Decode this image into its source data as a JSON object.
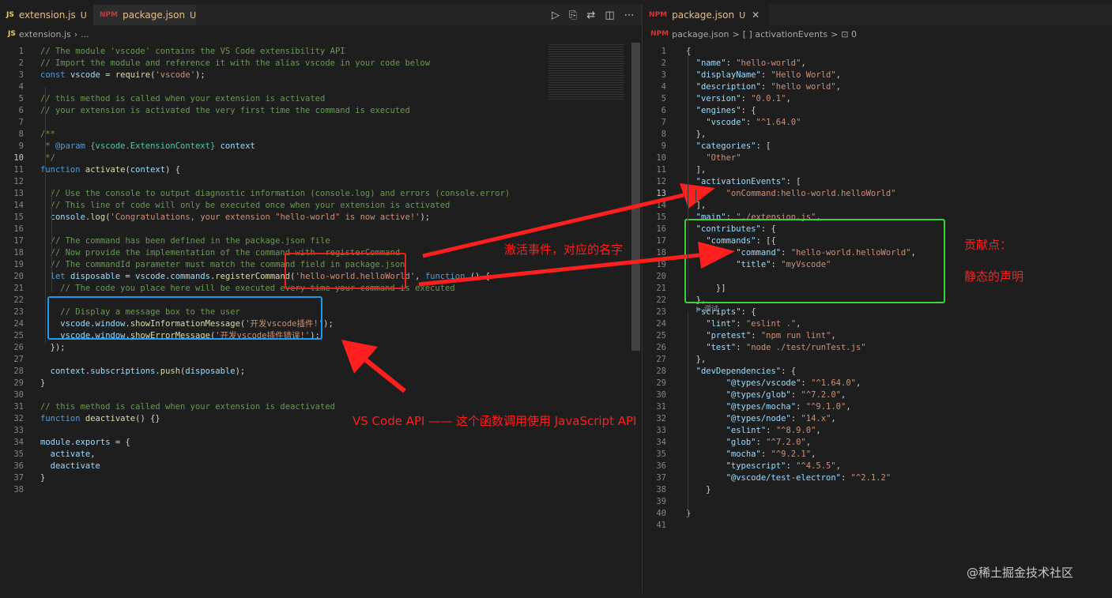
{
  "left_editor": {
    "tabs": [
      {
        "icon": "JS",
        "label": "extension.js",
        "badge": "U"
      },
      {
        "icon": "NPM",
        "label": "package.json",
        "badge": "U"
      }
    ],
    "breadcrumb": {
      "file": "extension.js",
      "rest": "..."
    },
    "lines": [
      [
        {
          "c": "c",
          "t": "// The module 'vscode' contains the VS Code extensibility API"
        }
      ],
      [
        {
          "c": "c",
          "t": "// Import the module and reference it with the alias vscode in your code below"
        }
      ],
      [
        {
          "c": "k",
          "t": "const "
        },
        {
          "c": "v",
          "t": "vscode"
        },
        {
          "c": "p",
          "t": " = "
        },
        {
          "c": "f",
          "t": "require"
        },
        {
          "c": "p",
          "t": "("
        },
        {
          "c": "s",
          "t": "'vscode'"
        },
        {
          "c": "p",
          "t": ");"
        }
      ],
      [],
      [
        {
          "c": "c",
          "t": "// this method is called when your extension is activated"
        }
      ],
      [
        {
          "c": "c",
          "t": "// your extension is activated the very first time the command is executed"
        }
      ],
      [],
      [
        {
          "c": "c",
          "t": "/**"
        }
      ],
      [
        {
          "c": "c",
          "t": " * "
        },
        {
          "c": "k",
          "t": "@param"
        },
        {
          "c": "c",
          "t": " "
        },
        {
          "c": "t",
          "t": "{vscode.ExtensionContext}"
        },
        {
          "c": "c",
          "t": " "
        },
        {
          "c": "v",
          "t": "context"
        }
      ],
      [
        {
          "c": "c",
          "t": " */"
        }
      ],
      [
        {
          "c": "k",
          "t": "function "
        },
        {
          "c": "f",
          "t": "activate"
        },
        {
          "c": "p",
          "t": "("
        },
        {
          "c": "v",
          "t": "context"
        },
        {
          "c": "p",
          "t": ") {"
        }
      ],
      [],
      [
        {
          "c": "c",
          "t": "  // Use the console to output diagnostic information (console.log) and errors (console.error)"
        }
      ],
      [
        {
          "c": "c",
          "t": "  // This line of code will only be executed once when your extension is activated"
        }
      ],
      [
        {
          "c": "v",
          "t": "  console"
        },
        {
          "c": "p",
          "t": "."
        },
        {
          "c": "f",
          "t": "log"
        },
        {
          "c": "p",
          "t": "("
        },
        {
          "c": "s",
          "t": "'Congratulations, your extension \"hello-world\" is now active!'"
        },
        {
          "c": "p",
          "t": ");"
        }
      ],
      [],
      [
        {
          "c": "c",
          "t": "  // The command has been defined in the package.json file"
        }
      ],
      [
        {
          "c": "c",
          "t": "  // Now provide the implementation of the command with  registerCommand"
        }
      ],
      [
        {
          "c": "c",
          "t": "  // The commandId parameter must match the command field in package.json"
        }
      ],
      [
        {
          "c": "k",
          "t": "  let "
        },
        {
          "c": "v",
          "t": "disposable"
        },
        {
          "c": "p",
          "t": " = "
        },
        {
          "c": "v",
          "t": "vscode"
        },
        {
          "c": "p",
          "t": "."
        },
        {
          "c": "v",
          "t": "commands"
        },
        {
          "c": "p",
          "t": "."
        },
        {
          "c": "f",
          "t": "registerCommand"
        },
        {
          "c": "p",
          "t": "("
        },
        {
          "c": "s",
          "t": "'hello-world.helloWorld'"
        },
        {
          "c": "p",
          "t": ", "
        },
        {
          "c": "k",
          "t": "function"
        },
        {
          "c": "p",
          "t": " () {"
        }
      ],
      [
        {
          "c": "c",
          "t": "    // The code you place here will be executed every time your command is executed"
        }
      ],
      [],
      [
        {
          "c": "c",
          "t": "    // Display a message box to the user"
        }
      ],
      [
        {
          "c": "v",
          "t": "    vscode"
        },
        {
          "c": "p",
          "t": "."
        },
        {
          "c": "v",
          "t": "window"
        },
        {
          "c": "p",
          "t": "."
        },
        {
          "c": "f",
          "t": "showInformationMessage"
        },
        {
          "c": "p",
          "t": "("
        },
        {
          "c": "s",
          "t": "'开发vscode插件!'"
        },
        {
          "c": "p",
          "t": ");"
        }
      ],
      [
        {
          "c": "v",
          "t": "    vscode"
        },
        {
          "c": "p",
          "t": "."
        },
        {
          "c": "v",
          "t": "window"
        },
        {
          "c": "p",
          "t": "."
        },
        {
          "c": "f",
          "t": "showErrorMessage"
        },
        {
          "c": "p",
          "t": "("
        },
        {
          "c": "s",
          "t": "'开发vscode插件错误!'"
        },
        {
          "c": "p",
          "t": ");"
        }
      ],
      [
        {
          "c": "p",
          "t": "  });"
        }
      ],
      [],
      [
        {
          "c": "v",
          "t": "  context"
        },
        {
          "c": "p",
          "t": "."
        },
        {
          "c": "v",
          "t": "subscriptions"
        },
        {
          "c": "p",
          "t": "."
        },
        {
          "c": "f",
          "t": "push"
        },
        {
          "c": "p",
          "t": "("
        },
        {
          "c": "v",
          "t": "disposable"
        },
        {
          "c": "p",
          "t": ");"
        }
      ],
      [
        {
          "c": "p",
          "t": "}"
        }
      ],
      [],
      [
        {
          "c": "c",
          "t": "// this method is called when your extension is deactivated"
        }
      ],
      [
        {
          "c": "k",
          "t": "function "
        },
        {
          "c": "f",
          "t": "deactivate"
        },
        {
          "c": "p",
          "t": "() {}"
        }
      ],
      [],
      [
        {
          "c": "v",
          "t": "module"
        },
        {
          "c": "p",
          "t": "."
        },
        {
          "c": "v",
          "t": "exports"
        },
        {
          "c": "p",
          "t": " = {"
        }
      ],
      [
        {
          "c": "v",
          "t": "  activate"
        },
        {
          "c": "p",
          "t": ","
        }
      ],
      [
        {
          "c": "v",
          "t": "  deactivate"
        }
      ],
      [
        {
          "c": "p",
          "t": "}"
        }
      ],
      []
    ]
  },
  "right_editor": {
    "tabs": [
      {
        "icon": "NPM",
        "label": "package.json",
        "badge": "U"
      }
    ],
    "breadcrumb": {
      "file": "package.json",
      "sep1": ">",
      "node": "[ ] activationEvents",
      "sep2": ">",
      "item": "⊡ 0"
    },
    "codelens": "▷ 调试",
    "lines": [
      [
        {
          "c": "p",
          "t": "{"
        }
      ],
      [
        {
          "c": "v",
          "t": "  \"name\""
        },
        {
          "c": "p",
          "t": ": "
        },
        {
          "c": "s",
          "t": "\"hello-world\""
        },
        {
          "c": "p",
          "t": ","
        }
      ],
      [
        {
          "c": "v",
          "t": "  \"displayName\""
        },
        {
          "c": "p",
          "t": ": "
        },
        {
          "c": "s",
          "t": "\"Hello World\""
        },
        {
          "c": "p",
          "t": ","
        }
      ],
      [
        {
          "c": "v",
          "t": "  \"description\""
        },
        {
          "c": "p",
          "t": ": "
        },
        {
          "c": "s",
          "t": "\"hello world\""
        },
        {
          "c": "p",
          "t": ","
        }
      ],
      [
        {
          "c": "v",
          "t": "  \"version\""
        },
        {
          "c": "p",
          "t": ": "
        },
        {
          "c": "s",
          "t": "\"0.0.1\""
        },
        {
          "c": "p",
          "t": ","
        }
      ],
      [
        {
          "c": "v",
          "t": "  \"engines\""
        },
        {
          "c": "p",
          "t": ": {"
        }
      ],
      [
        {
          "c": "v",
          "t": "    \"vscode\""
        },
        {
          "c": "p",
          "t": ": "
        },
        {
          "c": "s",
          "t": "\"^1.64.0\""
        }
      ],
      [
        {
          "c": "p",
          "t": "  },"
        }
      ],
      [
        {
          "c": "v",
          "t": "  \"categories\""
        },
        {
          "c": "p",
          "t": ": ["
        }
      ],
      [
        {
          "c": "s",
          "t": "    \"Other\""
        }
      ],
      [
        {
          "c": "p",
          "t": "  ],"
        }
      ],
      [
        {
          "c": "v",
          "t": "  \"activationEvents\""
        },
        {
          "c": "p",
          "t": ": ["
        }
      ],
      [
        {
          "c": "s",
          "t": "        \"onCommand:hello-world.helloWorld\""
        }
      ],
      [
        {
          "c": "p",
          "t": "  ],"
        }
      ],
      [
        {
          "c": "v",
          "t": "  \"main\""
        },
        {
          "c": "p",
          "t": ": "
        },
        {
          "c": "s",
          "t": "\"./extension.js\""
        },
        {
          "c": "p",
          "t": ","
        }
      ],
      [
        {
          "c": "v",
          "t": "  \"contributes\""
        },
        {
          "c": "p",
          "t": ": {"
        }
      ],
      [
        {
          "c": "v",
          "t": "    \"commands\""
        },
        {
          "c": "p",
          "t": ": [{"
        }
      ],
      [
        {
          "c": "v",
          "t": "          \"command\""
        },
        {
          "c": "p",
          "t": ": "
        },
        {
          "c": "s",
          "t": "\"hello-world.helloWorld\""
        },
        {
          "c": "p",
          "t": ","
        }
      ],
      [
        {
          "c": "v",
          "t": "          \"title\""
        },
        {
          "c": "p",
          "t": ": "
        },
        {
          "c": "s",
          "t": "\"myVscode\""
        }
      ],
      [],
      [
        {
          "c": "p",
          "t": "      }]"
        }
      ],
      [
        {
          "c": "p",
          "t": "  },"
        }
      ],
      [
        {
          "c": "v",
          "t": "  \"scripts\""
        },
        {
          "c": "p",
          "t": ": {"
        }
      ],
      [
        {
          "c": "v",
          "t": "    \"lint\""
        },
        {
          "c": "p",
          "t": ": "
        },
        {
          "c": "s",
          "t": "\"eslint .\""
        },
        {
          "c": "p",
          "t": ","
        }
      ],
      [
        {
          "c": "v",
          "t": "    \"pretest\""
        },
        {
          "c": "p",
          "t": ": "
        },
        {
          "c": "s",
          "t": "\"npm run lint\""
        },
        {
          "c": "p",
          "t": ","
        }
      ],
      [
        {
          "c": "v",
          "t": "    \"test\""
        },
        {
          "c": "p",
          "t": ": "
        },
        {
          "c": "s",
          "t": "\"node ./test/runTest.js\""
        }
      ],
      [
        {
          "c": "p",
          "t": "  },"
        }
      ],
      [
        {
          "c": "v",
          "t": "  \"devDependencies\""
        },
        {
          "c": "p",
          "t": ": {"
        }
      ],
      [
        {
          "c": "v",
          "t": "        \"@types/vscode\""
        },
        {
          "c": "p",
          "t": ": "
        },
        {
          "c": "s",
          "t": "\"^1.64.0\""
        },
        {
          "c": "p",
          "t": ","
        }
      ],
      [
        {
          "c": "v",
          "t": "        \"@types/glob\""
        },
        {
          "c": "p",
          "t": ": "
        },
        {
          "c": "s",
          "t": "\"^7.2.0\""
        },
        {
          "c": "p",
          "t": ","
        }
      ],
      [
        {
          "c": "v",
          "t": "        \"@types/mocha\""
        },
        {
          "c": "p",
          "t": ": "
        },
        {
          "c": "s",
          "t": "\"^9.1.0\""
        },
        {
          "c": "p",
          "t": ","
        }
      ],
      [
        {
          "c": "v",
          "t": "        \"@types/node\""
        },
        {
          "c": "p",
          "t": ": "
        },
        {
          "c": "s",
          "t": "\"14.x\""
        },
        {
          "c": "p",
          "t": ","
        }
      ],
      [
        {
          "c": "v",
          "t": "        \"eslint\""
        },
        {
          "c": "p",
          "t": ": "
        },
        {
          "c": "s",
          "t": "\"^8.9.0\""
        },
        {
          "c": "p",
          "t": ","
        }
      ],
      [
        {
          "c": "v",
          "t": "        \"glob\""
        },
        {
          "c": "p",
          "t": ": "
        },
        {
          "c": "s",
          "t": "\"^7.2.0\""
        },
        {
          "c": "p",
          "t": ","
        }
      ],
      [
        {
          "c": "v",
          "t": "        \"mocha\""
        },
        {
          "c": "p",
          "t": ": "
        },
        {
          "c": "s",
          "t": "\"^9.2.1\""
        },
        {
          "c": "p",
          "t": ","
        }
      ],
      [
        {
          "c": "v",
          "t": "        \"typescript\""
        },
        {
          "c": "p",
          "t": ": "
        },
        {
          "c": "s",
          "t": "\"^4.5.5\""
        },
        {
          "c": "p",
          "t": ","
        }
      ],
      [
        {
          "c": "v",
          "t": "        \"@vscode/test-electron\""
        },
        {
          "c": "p",
          "t": ": "
        },
        {
          "c": "s",
          "t": "\"^2.1.2\""
        }
      ],
      [
        {
          "c": "p",
          "t": "    }"
        }
      ],
      [],
      [
        {
          "c": "p",
          "t": "}"
        }
      ],
      []
    ]
  },
  "annotations": {
    "activation": "激活事件，对应的名字",
    "contribution_title": "贡献点：",
    "contribution_subtitle": "静态的声明",
    "api": "VS Code API —— 这个函数调用使用 JavaScript API"
  },
  "watermark": "@稀土掘金技术社区",
  "colors": {
    "arrow": "#ff1f1f",
    "box_red": "#e8231e",
    "box_blue": "#1e9bf0",
    "box_green": "#3cd23c"
  }
}
